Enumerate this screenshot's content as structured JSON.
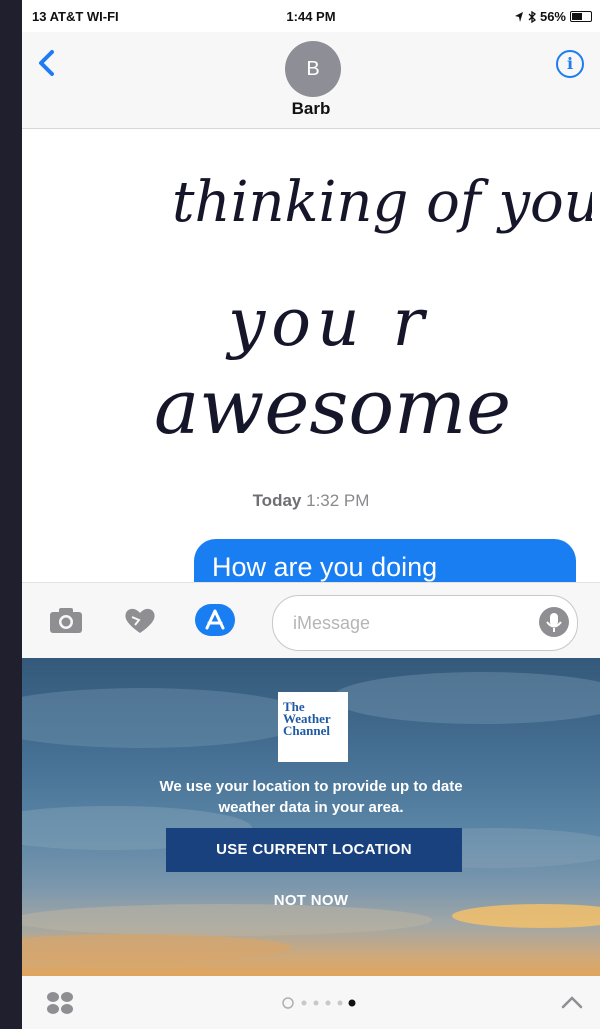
{
  "status_bar": {
    "carrier": "13 AT&T WI-FI",
    "time": "1:44 PM",
    "battery": "56%"
  },
  "header": {
    "avatar_initial": "B",
    "contact_name": "Barb"
  },
  "conversation": {
    "handwritten_message": [
      "thinking of you",
      "you r",
      "awesome"
    ],
    "timestamp_day": "Today",
    "timestamp_time": "1:32 PM",
    "sent_message": "How are you doing"
  },
  "composer": {
    "placeholder": "iMessage"
  },
  "weather_panel": {
    "logo_lines": [
      "The",
      "Weather",
      "Channel"
    ],
    "message_line1": "We use your location to provide up to date",
    "message_line2": "weather data in your area.",
    "primary_button": "USE CURRENT LOCATION",
    "secondary_button": "NOT NOW"
  },
  "icons": [
    "back-icon",
    "info-icon",
    "camera-icon",
    "heart-icon",
    "apps-icon",
    "mic-icon",
    "grid-icon",
    "chevron-up-icon"
  ],
  "colors": {
    "accent_blue": "#1a7ef3",
    "button_navy": "#18417d",
    "logo_blue": "#1f5aa6"
  }
}
